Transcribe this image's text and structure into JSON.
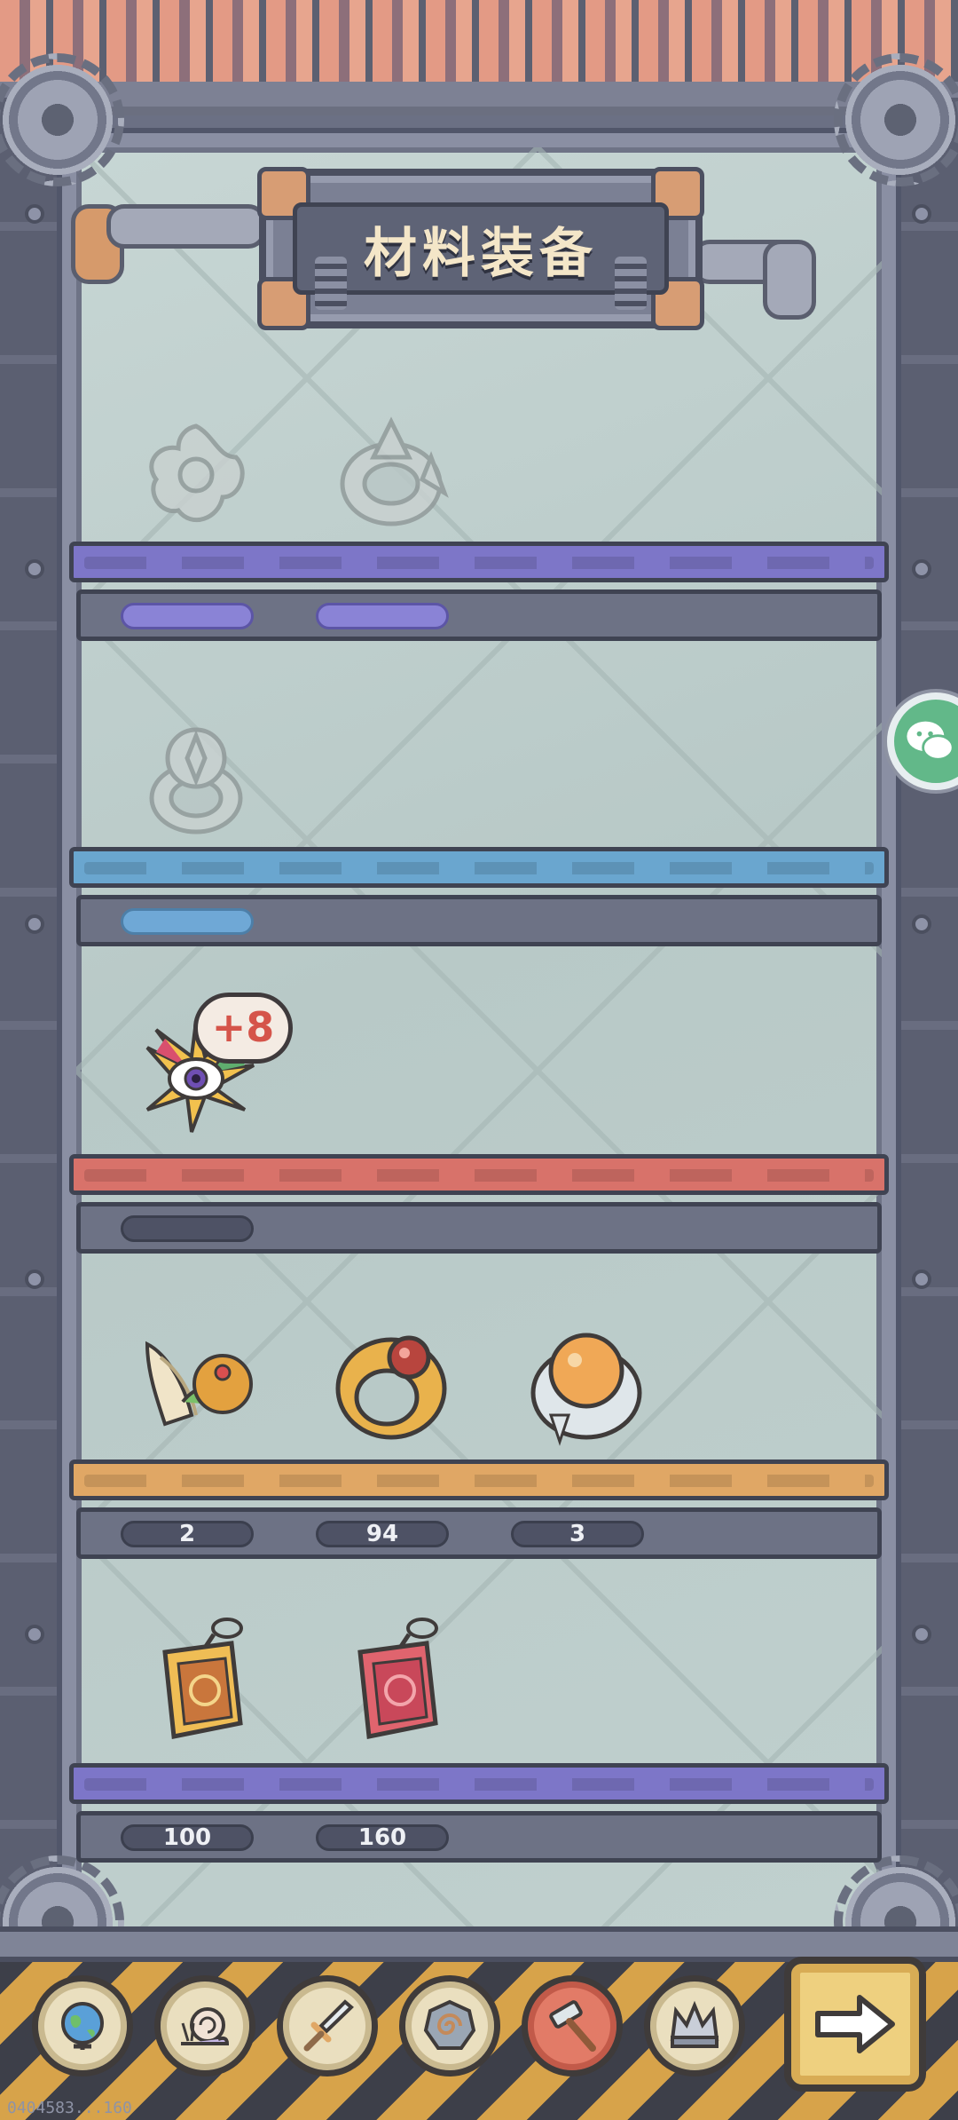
{
  "header": {
    "title": "材料装备"
  },
  "colors": {
    "shelf_purple": "#7d76c8",
    "shelf_blue": "#6aa6cf",
    "shelf_red": "#d8726a",
    "shelf_orange": "#e0a765",
    "badge_text": "#d5544a",
    "active_tool": "#e27b67"
  },
  "shelves": [
    {
      "color": "purple",
      "items": [
        {
          "icon": "grey-flower-emblem-icon",
          "count": "",
          "locked": true
        },
        {
          "icon": "grey-spiked-ring-icon",
          "count": "",
          "locked": true
        }
      ]
    },
    {
      "color": "blue",
      "items": [
        {
          "icon": "grey-flower-ring-icon",
          "count": "",
          "locked": true
        }
      ]
    },
    {
      "color": "red",
      "items": [
        {
          "icon": "winged-eye-brooch-icon",
          "count": "",
          "locked": false,
          "badge": "+8"
        }
      ]
    },
    {
      "color": "orange",
      "items": [
        {
          "icon": "winged-helmet-icon",
          "count": "2"
        },
        {
          "icon": "ruby-gold-ring-icon",
          "count": "94"
        },
        {
          "icon": "orange-orb-ring-icon",
          "count": "3"
        }
      ]
    },
    {
      "color": "purple",
      "items": [
        {
          "icon": "gold-rune-pendant-icon",
          "count": "100"
        },
        {
          "icon": "red-rune-pendant-icon",
          "count": "160"
        }
      ]
    }
  ],
  "toolbar": {
    "items": [
      {
        "icon": "globe-icon",
        "active": false
      },
      {
        "icon": "snail-icon",
        "active": false
      },
      {
        "icon": "sword-icon",
        "active": false
      },
      {
        "icon": "spiral-shield-icon",
        "active": false
      },
      {
        "icon": "hammer-icon",
        "active": true
      },
      {
        "icon": "crown-icon",
        "active": false
      }
    ],
    "next": {
      "icon": "arrow-right-icon"
    }
  },
  "side_button": {
    "icon": "wechat-icon"
  },
  "footer": {
    "uid": "0404583...160"
  }
}
